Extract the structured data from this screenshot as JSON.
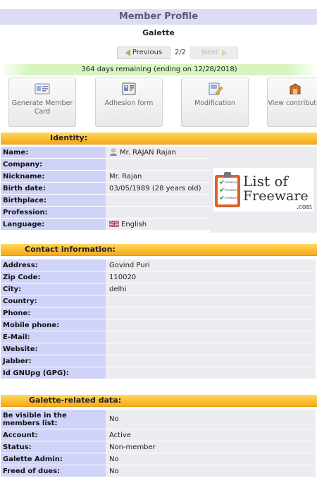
{
  "header": {
    "title": "Member Profile",
    "subtitle": "Galette"
  },
  "pager": {
    "previous": "Previous",
    "page": "2/2",
    "next": "Next"
  },
  "days_remaining": "364 days remaining (ending on 12/28/2018)",
  "actions": [
    {
      "label": "Generate Member Card",
      "icon": "member-card-icon"
    },
    {
      "label": "Adhesion form",
      "icon": "adhesion-form-icon"
    },
    {
      "label": "Modification",
      "icon": "edit-icon"
    },
    {
      "label": "View contributio",
      "icon": "contributions-icon"
    }
  ],
  "identity": {
    "title": "Identity:",
    "rows": [
      {
        "label": "Name:",
        "value": "Mr. RAJAN Rajan"
      },
      {
        "label": "Company:",
        "value": ""
      },
      {
        "label": "Nickname:",
        "value": "Mr. Rajan"
      },
      {
        "label": "Birth date:",
        "value": "03/05/1989 (28 years old)"
      },
      {
        "label": "Birthplace:",
        "value": ""
      },
      {
        "label": "Profession:",
        "value": ""
      },
      {
        "label": "Language:",
        "value": "English"
      }
    ]
  },
  "logo": {
    "line1": "List of",
    "line2": "Freeware",
    "suffix": ".com",
    "list_items": [
      "freeware",
      "freeware",
      "freeware"
    ]
  },
  "contact": {
    "title": "Contact information:",
    "rows": [
      {
        "label": "Address:",
        "value": "Govind Puri"
      },
      {
        "label": "Zip Code:",
        "value": "110020"
      },
      {
        "label": "City:",
        "value": "delhi"
      },
      {
        "label": "Country:",
        "value": ""
      },
      {
        "label": "Phone:",
        "value": ""
      },
      {
        "label": "Mobile phone:",
        "value": ""
      },
      {
        "label": "E-Mail:",
        "value": ""
      },
      {
        "label": "Website:",
        "value": ""
      },
      {
        "label": "Jabber:",
        "value": ""
      },
      {
        "label": "Id GNUpg (GPG):",
        "value": ""
      }
    ]
  },
  "galette": {
    "title": "Galette-related data:",
    "rows": [
      {
        "label": "Be visible in the members list:",
        "value": "No"
      },
      {
        "label": "Account:",
        "value": "Active"
      },
      {
        "label": "Status:",
        "value": "Non-member"
      },
      {
        "label": "Galette Admin:",
        "value": "No"
      },
      {
        "label": "Freed of dues:",
        "value": "No"
      }
    ]
  },
  "colors": {
    "header_bg": "#dcdcf4",
    "section_orange": "#f7a91b",
    "label_bg": "#d0d3f8",
    "value_bg": "#ececf0",
    "days_green": "#d6f5c0"
  }
}
